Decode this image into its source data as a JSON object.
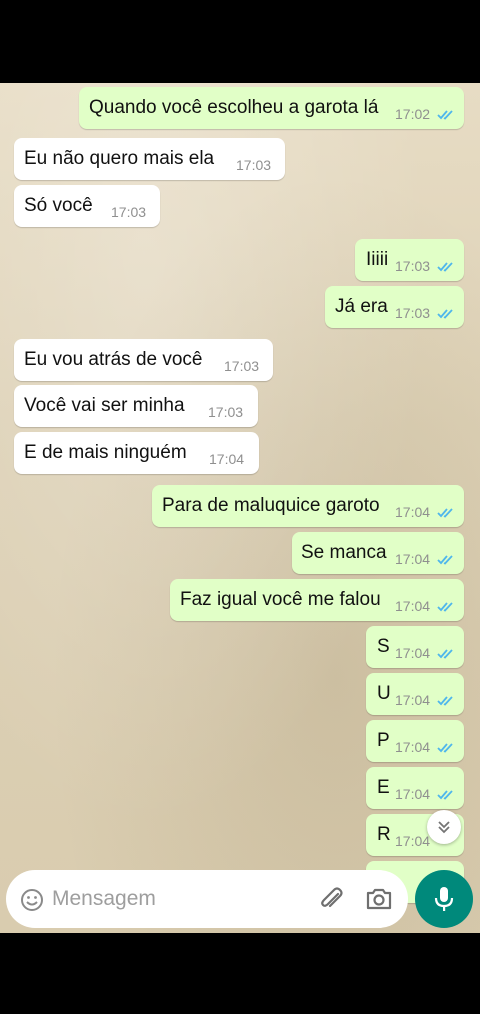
{
  "messages": [
    {
      "dir": "out",
      "text": "Quando você escolheu a garota lá",
      "time": "17:02"
    },
    {
      "dir": "in",
      "text": "Eu não quero mais ela",
      "time": "17:03"
    },
    {
      "dir": "in",
      "text": "Só você",
      "time": "17:03"
    },
    {
      "dir": "out",
      "text": "Iiiii",
      "time": "17:03"
    },
    {
      "dir": "out",
      "text": "Já era",
      "time": "17:03"
    },
    {
      "dir": "in",
      "text": "Eu vou atrás de você",
      "time": "17:03"
    },
    {
      "dir": "in",
      "text": "Você vai ser minha",
      "time": "17:03"
    },
    {
      "dir": "in",
      "text": "E de mais ninguém",
      "time": "17:04"
    },
    {
      "dir": "out",
      "text": "Para de maluquice garoto",
      "time": "17:04"
    },
    {
      "dir": "out",
      "text": "Se manca",
      "time": "17:04"
    },
    {
      "dir": "out",
      "text": "Faz igual você me falou",
      "time": "17:04"
    },
    {
      "dir": "out",
      "text": "S",
      "time": "17:04"
    },
    {
      "dir": "out",
      "text": "U",
      "time": "17:04"
    },
    {
      "dir": "out",
      "text": "P",
      "time": "17:04"
    },
    {
      "dir": "out",
      "text": "E",
      "time": "17:04"
    },
    {
      "dir": "out",
      "text": "R",
      "time": "17:04"
    }
  ],
  "composer": {
    "placeholder": "Mensagem"
  },
  "icons": {
    "emoji": "emoji-icon",
    "attach": "paperclip-icon",
    "camera": "camera-icon",
    "mic": "microphone-icon",
    "scroll": "chevron-double-down-icon",
    "read": "double-check-icon"
  },
  "colors": {
    "incoming": "#ffffff",
    "outgoing": "#e1ffc7",
    "read_ticks": "#4fb6ec",
    "accent": "#00897b"
  }
}
